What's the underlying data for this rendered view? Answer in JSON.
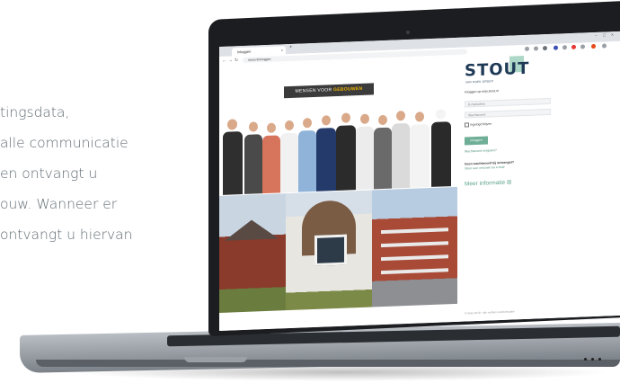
{
  "background_text": {
    "lines": [
      "tingsdata,",
      "alle communicatie",
      " en ontvangt u",
      "ouw. Wanneer er",
      "ontvangt u hiervan"
    ]
  },
  "browser": {
    "tab_title": "Inloggen",
    "new_tab": "+",
    "url": "stout.nl/inloggen",
    "window_controls": [
      "–",
      "□",
      "×"
    ]
  },
  "hero": {
    "banner_prefix": "MENSEN VOOR ",
    "banner_highlight": "GEBOUWEN"
  },
  "login": {
    "logo": "STOUT",
    "logo_sub": "VAN HOEK GROEP",
    "intro": "Inloggen op mijn.stout.nl",
    "email_placeholder": "E-mailadres",
    "password_placeholder": "Wachtwoord",
    "remember_label": "Ingelogd blijven",
    "submit_label": "Inloggen",
    "forgot_link": "Wachtwoord vergeten?",
    "no_account_title": "Geen wachtwoord bij ontvangst?",
    "no_account_link": "Stuur een verzoek via e-mail",
    "more_info": "Meer informatie ⊞",
    "footer": "© Stout 2019 - alle rechten voorbehouden"
  },
  "colors": {
    "brand_navy": "#1f3a56",
    "brand_green": "#6fae97",
    "banner_yellow": "#f2b600"
  }
}
